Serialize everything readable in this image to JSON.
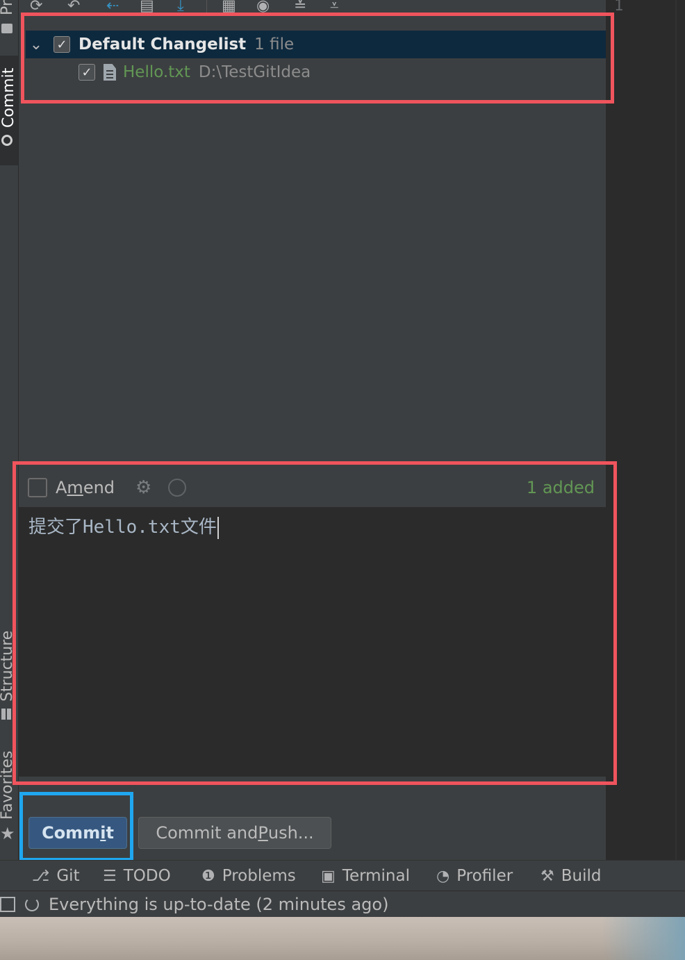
{
  "left_sidebar": {
    "top_label": "Pr",
    "commit_tab": "Commit",
    "structure_tab": "Structure",
    "favorites_tab": "Favorites"
  },
  "toolbar": {
    "icons": [
      "refresh-icon",
      "rollback-icon",
      "update-icon",
      "shelve-icon",
      "download-icon",
      "group-by-icon",
      "view-options-icon",
      "expand-all-icon",
      "collapse-all-icon"
    ]
  },
  "changes_tree": {
    "changelist_name": "Default Changelist",
    "changelist_count": "1 file",
    "changelist_checked": true,
    "files": [
      {
        "name": "Hello.txt",
        "path": "D:\\TestGitIdea",
        "checked": true,
        "status_color": "#629755"
      }
    ]
  },
  "commit_options": {
    "amend_label_pre": "A",
    "amend_label_mnemonic": "m",
    "amend_label_post": "end",
    "amend_checked": false,
    "summary": "1 added"
  },
  "commit_message": "提交了Hello.txt文件",
  "buttons": {
    "commit_pre": "Comm",
    "commit_mnemonic": "i",
    "commit_post": "t",
    "commit_push_pre": "Commit and ",
    "commit_push_mnemonic": "P",
    "commit_push_post": "ush..."
  },
  "editor": {
    "line_number": "1"
  },
  "bottom_tabs": [
    {
      "label": "Git",
      "icon": "git-branch-icon"
    },
    {
      "label": "TODO",
      "icon": "list-icon"
    },
    {
      "label": "Problems",
      "icon": "problems-icon"
    },
    {
      "label": "Terminal",
      "icon": "terminal-icon"
    },
    {
      "label": "Profiler",
      "icon": "profiler-icon"
    },
    {
      "label": "Build",
      "icon": "hammer-icon"
    }
  ],
  "status_bar": {
    "text": "Everything is up-to-date (2 minutes ago)"
  },
  "colors": {
    "highlight_red": "#f0545d",
    "highlight_blue": "#1fa7f0",
    "added_green": "#629755",
    "selection": "#0d293e"
  }
}
